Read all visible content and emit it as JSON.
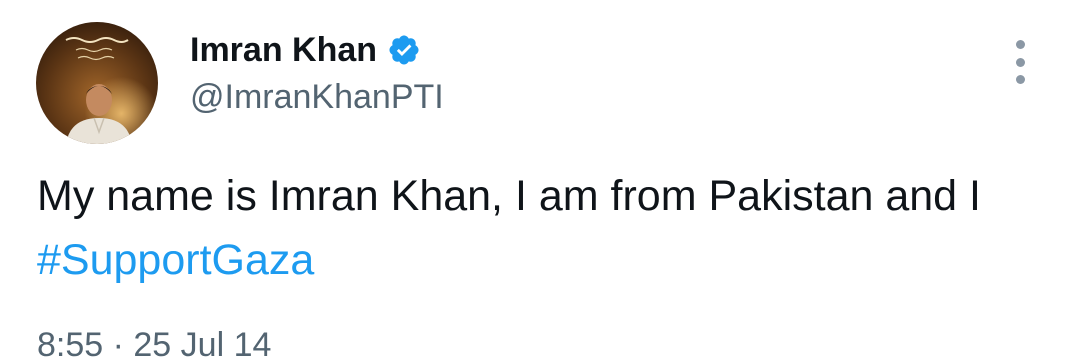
{
  "author": {
    "display_name": "Imran Khan",
    "handle": "@ImranKhanPTI",
    "verified": true,
    "avatar_icon": "profile-photo",
    "avatar_overlay_text": "بس نام رہے گا اللہ کا"
  },
  "tweet": {
    "text_before": "My name is Imran Khan, I am from Pakistan and I ",
    "hashtag": "#SupportGaza",
    "timestamp": "8:55 · 25 Jul 14"
  },
  "menu": {
    "icon": "more-options-icon"
  },
  "colors": {
    "link": "#1d9bf0",
    "verified": "#1d9bf0",
    "secondary_text": "#536471",
    "text": "#0f1419"
  }
}
